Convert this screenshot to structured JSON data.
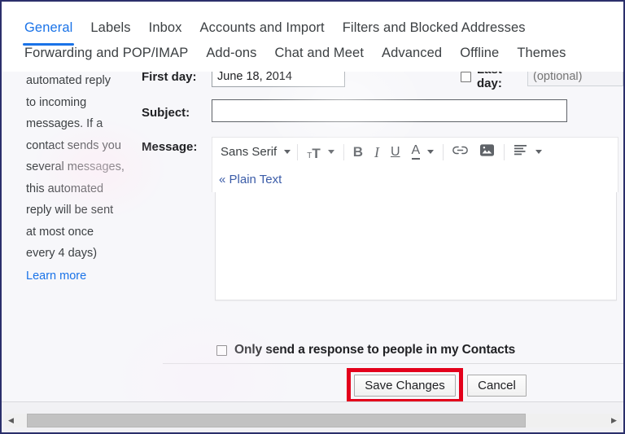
{
  "tabs_row1": [
    {
      "label": "General",
      "active": true
    },
    {
      "label": "Labels",
      "active": false
    },
    {
      "label": "Inbox",
      "active": false
    },
    {
      "label": "Accounts and Import",
      "active": false
    },
    {
      "label": "Filters and Blocked Addresses",
      "active": false
    }
  ],
  "tabs_row2": [
    {
      "label": "Forwarding and POP/IMAP"
    },
    {
      "label": "Add-ons"
    },
    {
      "label": "Chat and Meet"
    },
    {
      "label": "Advanced"
    },
    {
      "label": "Offline"
    },
    {
      "label": "Themes"
    }
  ],
  "description": {
    "lines": [
      "automated reply",
      "to incoming",
      "messages. If a",
      "contact sends you",
      "several messages,",
      "this automated",
      "reply will be sent",
      "at most once",
      "every 4 days)"
    ],
    "learn_more": "Learn more"
  },
  "form": {
    "first_day_label": "First day:",
    "first_day_value": "June 18, 2014",
    "last_day_label": "Last day:",
    "last_day_placeholder": "(optional)",
    "last_day_checked": false,
    "subject_label": "Subject:",
    "subject_value": "",
    "subject_placeholder": "",
    "message_label": "Message:",
    "message_value": "",
    "plain_text_link": "« Plain Text",
    "contacts_label": "Only send a response to people in my Contacts",
    "contacts_checked": false
  },
  "toolbar": {
    "font_name": "Sans Serif",
    "font_size_icon": "font-size",
    "bold": "B",
    "italic": "I",
    "underline": "U",
    "text_color": "A",
    "link_icon": "link",
    "image_icon": "image",
    "align_icon": "align-left"
  },
  "buttons": {
    "save": "Save Changes",
    "cancel": "Cancel"
  },
  "scrollbar": {
    "left_arrow": "◀",
    "right_arrow": "▶"
  },
  "colors": {
    "accent_blue": "#1a73e8",
    "link_blue": "#3b5ca8",
    "highlight_red": "#e3001b",
    "text_dark": "#202124",
    "panel_bg": "#f7f7fa",
    "frame_border": "#2b2f6b"
  }
}
